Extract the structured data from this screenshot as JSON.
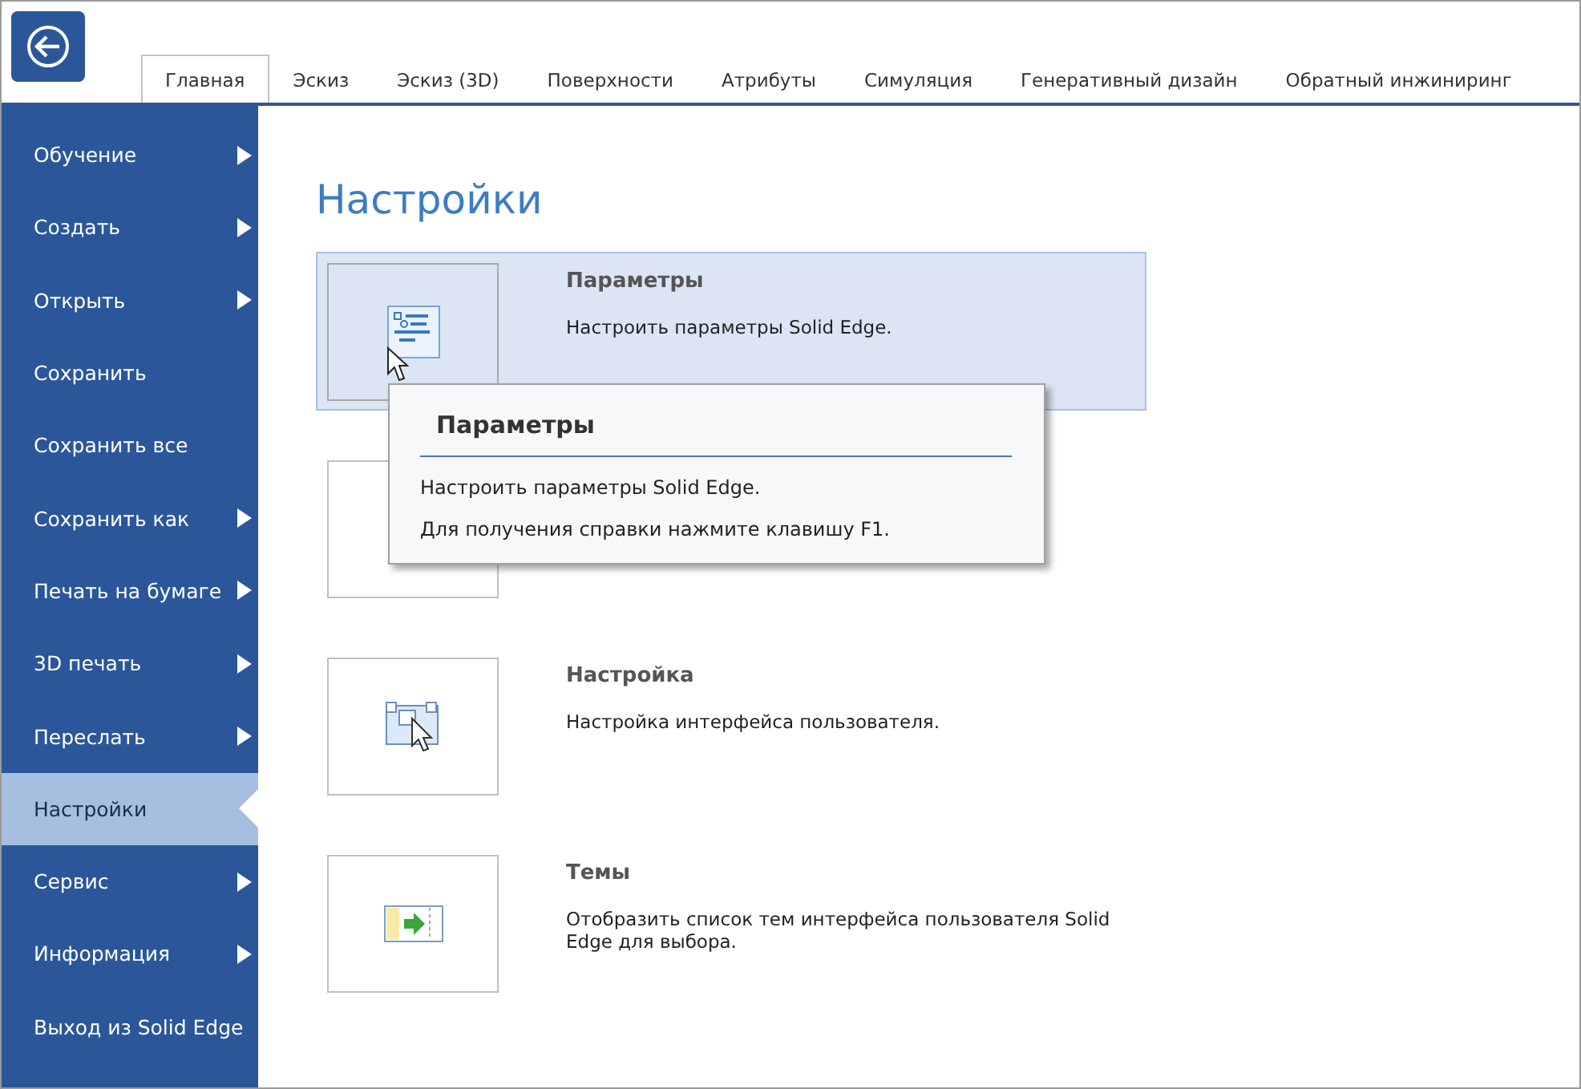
{
  "tabs": [
    {
      "label": "Главная",
      "selected": true
    },
    {
      "label": "Эскиз",
      "selected": false
    },
    {
      "label": "Эскиз (3D)",
      "selected": false
    },
    {
      "label": "Поверхности",
      "selected": false
    },
    {
      "label": "Атрибуты",
      "selected": false
    },
    {
      "label": "Симуляция",
      "selected": false
    },
    {
      "label": "Генеративный дизайн",
      "selected": false
    },
    {
      "label": "Обратный инжиниринг",
      "selected": false
    }
  ],
  "sidebar": {
    "items": [
      {
        "label": "Обучение",
        "submenu": true,
        "selected": false
      },
      {
        "label": "Создать",
        "submenu": true,
        "selected": false
      },
      {
        "label": "Открыть",
        "submenu": true,
        "selected": false
      },
      {
        "label": "Сохранить",
        "submenu": false,
        "selected": false
      },
      {
        "label": "Сохранить все",
        "submenu": false,
        "selected": false
      },
      {
        "label": "Сохранить как",
        "submenu": true,
        "selected": false
      },
      {
        "label": "Печать на бумаге",
        "submenu": true,
        "selected": false
      },
      {
        "label": "3D печать",
        "submenu": true,
        "selected": false
      },
      {
        "label": "Переслать",
        "submenu": true,
        "selected": false
      },
      {
        "label": "Настройки",
        "submenu": false,
        "selected": true
      },
      {
        "label": "Сервис",
        "submenu": true,
        "selected": false
      },
      {
        "label": "Информация",
        "submenu": true,
        "selected": false
      },
      {
        "label": "Выход из Solid Edge",
        "submenu": false,
        "selected": false
      }
    ]
  },
  "page_title": "Настройки",
  "options": [
    {
      "kind": "parameters",
      "title": "Параметры",
      "description": "Настроить параметры Solid Edge.",
      "selected": true
    },
    {
      "kind": "hidden"
    },
    {
      "kind": "customize",
      "title": "Настройка",
      "description": "Настройка интерфейса пользователя.",
      "selected": false
    },
    {
      "kind": "themes",
      "title": "Темы",
      "description": "Отобразить список тем интерфейса пользователя Solid Edge для выбора.",
      "selected": false
    }
  ],
  "tooltip": {
    "title": "Параметры",
    "lines": [
      "Настроить параметры Solid Edge.",
      "Для получения справки нажмите клавишу F1."
    ]
  }
}
